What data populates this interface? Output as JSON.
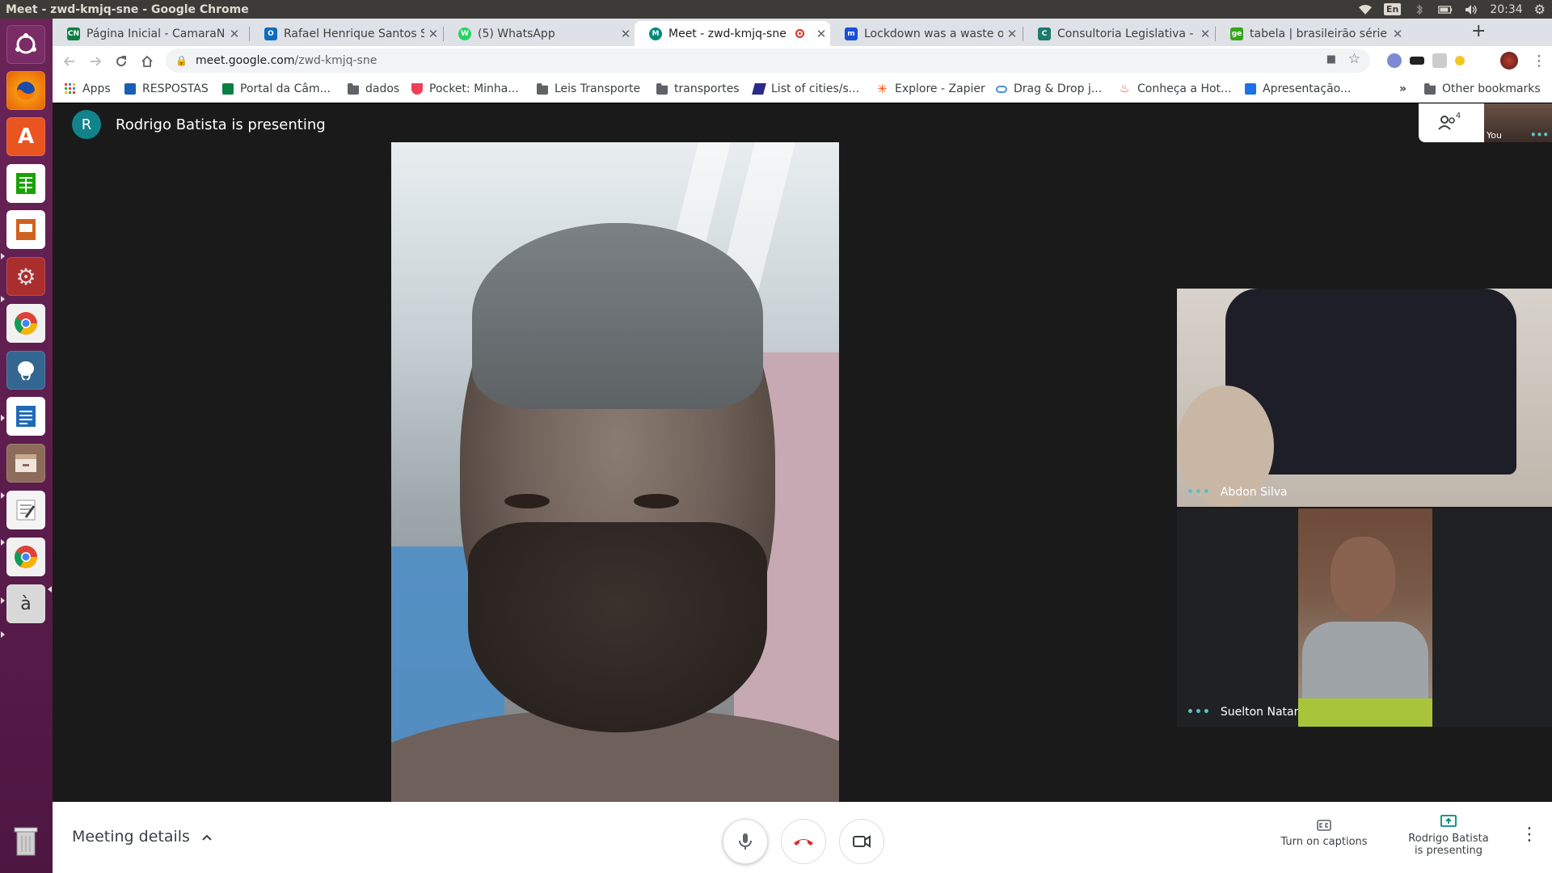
{
  "os": {
    "window_title": "Meet - zwd-kmjq-sne - Google Chrome",
    "keyboard_layout": "En",
    "clock": "20:34"
  },
  "launcher": {
    "items": [
      "ubuntu-dash",
      "firefox",
      "software-center",
      "spreadsheet",
      "presentation",
      "system-settings",
      "chrome",
      "postgresql",
      "writer",
      "files",
      "text-editor",
      "chrome-active",
      "character-map",
      "trash"
    ]
  },
  "tabs": [
    {
      "label": "Página Inicial - CamaraNe",
      "favicon": "CN",
      "color": "#0b8043"
    },
    {
      "label": "Rafael Henrique Santos S",
      "favicon": "O",
      "color": "#0f6cbd"
    },
    {
      "label": "(5) WhatsApp",
      "favicon": "W",
      "color": "#25d366"
    },
    {
      "label": "Meet - zwd-kmjq-sne",
      "favicon": "M",
      "color": "#00897b"
    },
    {
      "label": "Lockdown was a waste of",
      "favicon": "m",
      "color": "#1a4fd6"
    },
    {
      "label": "Consultoria Legislativa - S",
      "favicon": "C",
      "color": "#1f7a6e"
    },
    {
      "label": "tabela | brasileirão série b",
      "favicon": "ge",
      "color": "#35a51c"
    }
  ],
  "address_bar": {
    "host": "meet.google.com",
    "path": "/zwd-kmjq-sne"
  },
  "bookmarks": {
    "items": [
      {
        "label": "Apps",
        "kind": "apps"
      },
      {
        "label": "RESPOSTAS",
        "kind": "site"
      },
      {
        "label": "Portal da Câm...",
        "kind": "site"
      },
      {
        "label": "dados",
        "kind": "folder"
      },
      {
        "label": "Pocket: Minha...",
        "kind": "site"
      },
      {
        "label": "Leis Transporte",
        "kind": "folder"
      },
      {
        "label": "transportes",
        "kind": "folder"
      },
      {
        "label": "List of cities/s...",
        "kind": "site"
      },
      {
        "label": "Explore - Zapier",
        "kind": "site"
      },
      {
        "label": "Drag & Drop j...",
        "kind": "site"
      },
      {
        "label": "Conheça a Hot...",
        "kind": "site"
      },
      {
        "label": "Apresentação...",
        "kind": "site"
      }
    ],
    "overflow": "»",
    "other": "Other bookmarks"
  },
  "meet": {
    "presenter_initial": "R",
    "presenter_text": "Rodrigo Batista is presenting",
    "participants_count": "4",
    "self_label": "You",
    "tiles": [
      {
        "name": "Abdon Silva"
      },
      {
        "name": "Suelton Natan"
      }
    ]
  },
  "bottom_bar": {
    "meeting_details": "Meeting details",
    "captions_label": "Turn on captions",
    "presenting_line1": "Rodrigo Batista",
    "presenting_line2": "is presenting"
  }
}
